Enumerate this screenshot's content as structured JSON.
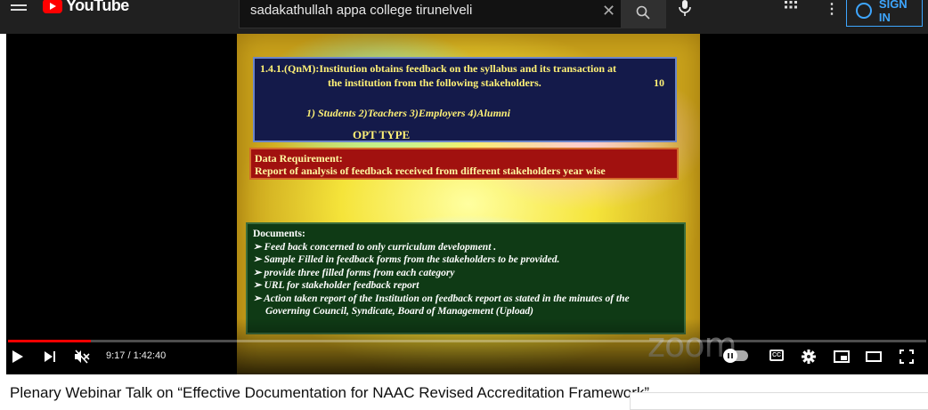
{
  "header": {
    "logo_text": "YouTube",
    "search_value": "sadakathullah appa college tirunelveli",
    "signin_label": "SIGN IN"
  },
  "slide": {
    "question_line1": "1.4.1.(QnM):Institution obtains  feedback on the syllabus and its transaction at",
    "question_line2": "the institution from the following  stakeholders.",
    "marks": "10",
    "stakeholders": "1) Students 2)Teachers 3)Employers 4)Alumni",
    "opt_type": "OPT TYPE",
    "data_req_title": "Data Requirement:",
    "data_req_text": "Report of analysis of feedback received from different stakeholders year wise",
    "documents_title": "Documents:",
    "documents": [
      "➢  Feed back concerned to only curriculum development .",
      "➢  Sample Filled in feedback forms from the stakeholders to be provided.",
      "➢  provide three filled forms from each category",
      "➢   URL for stakeholder feedback report",
      "➢  Action taken report of the Institution on feedback report as stated in the minutes of the"
    ],
    "documents_continuation": "Governing Council, Syndicate, Board of Management (Upload)",
    "watermark": "zoom"
  },
  "player": {
    "time_display": "9:17 / 1:42:40",
    "progress_fraction": 0.0905,
    "loaded_fraction": 0.0905,
    "cc_label": "CC"
  },
  "video": {
    "title": "Plenary Webinar Talk on “Effective Documentation for NAAC Revised Accreditation Framework”"
  },
  "colors": {
    "accent_red": "#ff0000",
    "link_blue": "#3ea6ff"
  }
}
